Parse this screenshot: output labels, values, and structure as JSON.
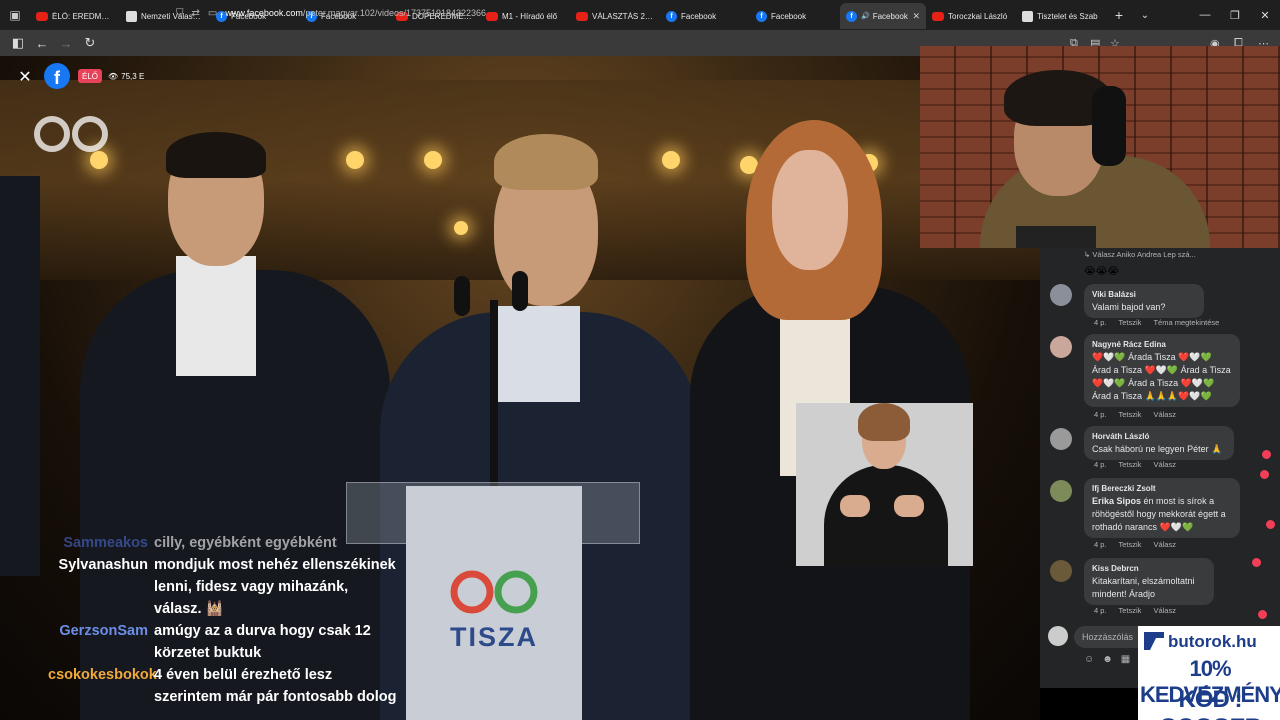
{
  "browser": {
    "tabs": [
      {
        "icon": "youtube-icon",
        "title": "ÉLŐ: EREDMÉNYE"
      },
      {
        "icon": "nvi-icon",
        "title": "Nemzeti Választás"
      },
      {
        "icon": "facebook-icon",
        "title": "Facebook"
      },
      {
        "icon": "facebook-icon",
        "title": "Facebook"
      },
      {
        "icon": "youtube-icon",
        "title": "DOPEREDMÉNYV"
      },
      {
        "icon": "youtube-icon",
        "title": "M1 - Híradó élő"
      },
      {
        "icon": "youtube-icon",
        "title": "VÁLASZTÁS 2026"
      },
      {
        "icon": "facebook-icon",
        "title": "Facebook"
      },
      {
        "icon": "facebook-icon",
        "title": "Facebook"
      },
      {
        "icon": "facebook-icon",
        "title": "Facebook",
        "active": true
      },
      {
        "icon": "youtube-icon",
        "title": "Toroczkai László"
      },
      {
        "icon": "nvi-icon",
        "title": "Tisztelet és Szab"
      }
    ],
    "url_domain": "www.facebook.com",
    "url_path": "/peter.magyar.102/videos/1737519184322366"
  },
  "video": {
    "live_label": "ÉLŐ",
    "viewer_count": "75,3 E",
    "podium_text": "TISZA"
  },
  "chat": [
    {
      "user": "Sammeakos",
      "color": "#4a6bd1",
      "lines": [
        "cilly, egyébként egyébként"
      ],
      "cut": true
    },
    {
      "user": "Sylvanashun",
      "color": "#ffffff",
      "lines": [
        "mondjuk most nehéz ellenszékinek",
        "lenni, fidesz vagy mihazánk,",
        "válasz. 🕍"
      ]
    },
    {
      "user": "GerzsonSam",
      "color": "#6d8ee8",
      "lines": [
        "amúgy az a durva hogy csak 12",
        "körzetet buktuk"
      ]
    },
    {
      "user": "csokokesbokok",
      "color": "#f0a93a",
      "lines": [
        "4 éven belül érezhető lesz",
        "szerintem már pár fontosabb dolog"
      ]
    }
  ],
  "comments": {
    "top_reply": "Válasz Aniko Andrea Lep szá...",
    "top_emojis": "😭😭😭",
    "items": [
      {
        "name": "Viki Balázsi",
        "text": "Valami bajod van?",
        "meta": [
          "4 p.",
          "Tetszik",
          "Téma megtekintése"
        ]
      },
      {
        "name": "Nagyné Rácz Edina",
        "text": "❤️🤍💚 Árada Tisza ❤️🤍💚 Árad a Tisza ❤️🤍💚 Árad a Tisza ❤️🤍💚 Árad a Tisza ❤️🤍💚 Árad a Tisza 🙏🙏🙏❤️🤍💚",
        "meta": [
          "4 p.",
          "Tetszik",
          "Válasz"
        ]
      },
      {
        "name": "Horváth László",
        "text": "Csak háború ne legyen Péter 🙏",
        "meta": [
          "4 p.",
          "Tetszik",
          "Válasz"
        ]
      },
      {
        "name": "Ifj Bereczki Zsolt",
        "reply_to": "Erika Sipos",
        "text": "én most is sírok a röhögéstől hogy mekkorát égett a rothadó narancs ❤️🤍💚",
        "meta": [
          "4 p.",
          "Tetszik",
          "Válasz"
        ]
      },
      {
        "name": "Kiss Debrcn",
        "text": "Kitakarítani, elszámoltatni mindent! Áradjo",
        "meta": [
          "4 p.",
          "Tetszik",
          "Válasz"
        ]
      }
    ],
    "compose_placeholder": "Hozzászólás"
  },
  "ad": {
    "brand": "butorok.hu",
    "line1": "10% KEDVEZMÉNY",
    "line2": "KÓD : GOGGER"
  }
}
